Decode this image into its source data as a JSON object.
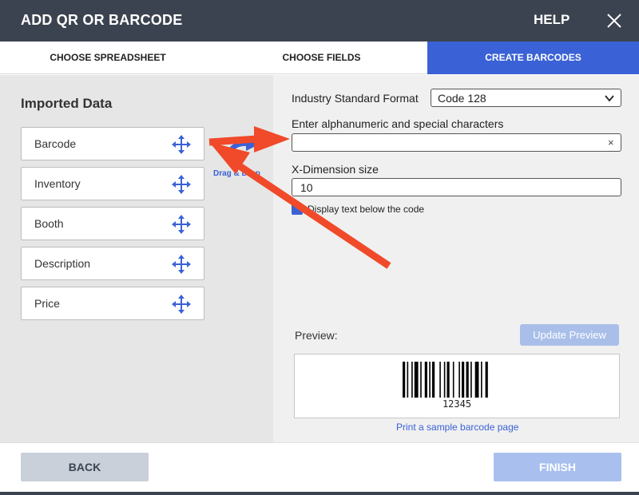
{
  "window": {
    "title": "ADD QR OR BARCODE",
    "help_label": "HELP",
    "close_icon": "close-icon"
  },
  "tabs": [
    {
      "label": "CHOOSE SPREADSHEET",
      "active": false
    },
    {
      "label": "CHOOSE FIELDS",
      "active": false
    },
    {
      "label": "CREATE BARCODES",
      "active": true
    }
  ],
  "imported": {
    "heading": "Imported Data",
    "fields": [
      "Barcode",
      "Inventory",
      "Booth",
      "Description",
      "Price"
    ],
    "move_icon": "move-icon"
  },
  "drag_drop_label": "Drag & Drop",
  "form": {
    "format_label": "Industry Standard Format",
    "format_value": "Code 128",
    "chars_label": "Enter alphanumeric and special characters",
    "chars_value": "",
    "clear_icon": "×",
    "xdim_label": "X-Dimension size",
    "xdim_value": "10",
    "display_text_label": "Display text below the code",
    "display_text_checked": true
  },
  "preview": {
    "label": "Preview:",
    "update_label": "Update Preview",
    "barcode_text": "12345",
    "sample_link": "Print a sample barcode page"
  },
  "footer": {
    "back_label": "BACK",
    "finish_label": "FINISH"
  },
  "colors": {
    "accent": "#3a62d6",
    "header_bg": "#3c4350",
    "annotation_arrow": "#f04a2a"
  }
}
